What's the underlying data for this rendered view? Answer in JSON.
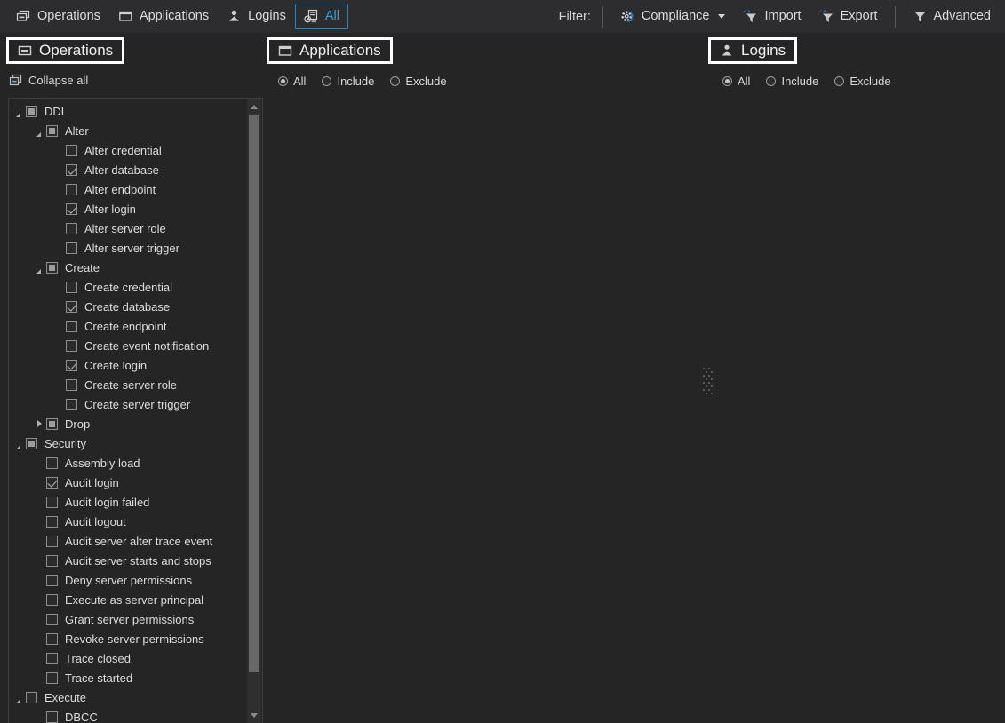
{
  "toolbar": {
    "left_buttons": [
      {
        "label": "Operations",
        "icon": "operations-icon",
        "active": false
      },
      {
        "label": "Applications",
        "icon": "applications-icon",
        "active": false
      },
      {
        "label": "Logins",
        "icon": "logins-icon",
        "active": false
      },
      {
        "label": "All",
        "icon": "all-icon",
        "active": true
      }
    ],
    "filter_label": "Filter:",
    "right_buttons": [
      {
        "label": "Compliance",
        "icon": "compliance-gear-icon",
        "has_caret": true
      },
      {
        "label": "Import",
        "icon": "import-funnel-icon",
        "has_caret": false
      },
      {
        "label": "Export",
        "icon": "export-funnel-icon",
        "has_caret": false
      },
      {
        "label": "Advanced",
        "icon": "funnel-icon",
        "has_caret": false
      }
    ],
    "accent_color": "#3a9bdc",
    "accent_border": "#1b8ad4"
  },
  "panels": {
    "operations": {
      "title": "Operations",
      "icon": "operations-icon",
      "collapse_all_label": "Collapse all",
      "collapse_all_icon": "collapse-all-icon"
    },
    "applications": {
      "title": "Applications",
      "icon": "applications-icon",
      "modes": [
        {
          "label": "All",
          "selected": true
        },
        {
          "label": "Include",
          "selected": false
        },
        {
          "label": "Exclude",
          "selected": false
        }
      ]
    },
    "logins": {
      "title": "Logins",
      "icon": "logins-icon",
      "modes": [
        {
          "label": "All",
          "selected": true
        },
        {
          "label": "Include",
          "selected": false
        },
        {
          "label": "Exclude",
          "selected": false
        }
      ]
    }
  },
  "tree": [
    {
      "label": "DDL",
      "level": 0,
      "expander": "open",
      "check": "indeterminate"
    },
    {
      "label": "Alter",
      "level": 1,
      "expander": "open",
      "check": "indeterminate"
    },
    {
      "label": "Alter credential",
      "level": 2,
      "expander": "none",
      "check": "unchecked"
    },
    {
      "label": "Alter database",
      "level": 2,
      "expander": "none",
      "check": "checked"
    },
    {
      "label": "Alter endpoint",
      "level": 2,
      "expander": "none",
      "check": "unchecked"
    },
    {
      "label": "Alter login",
      "level": 2,
      "expander": "none",
      "check": "checked"
    },
    {
      "label": "Alter server role",
      "level": 2,
      "expander": "none",
      "check": "unchecked"
    },
    {
      "label": "Alter server trigger",
      "level": 2,
      "expander": "none",
      "check": "unchecked"
    },
    {
      "label": "Create",
      "level": 1,
      "expander": "open",
      "check": "indeterminate"
    },
    {
      "label": "Create credential",
      "level": 2,
      "expander": "none",
      "check": "unchecked"
    },
    {
      "label": "Create database",
      "level": 2,
      "expander": "none",
      "check": "checked"
    },
    {
      "label": "Create endpoint",
      "level": 2,
      "expander": "none",
      "check": "unchecked"
    },
    {
      "label": "Create event notification",
      "level": 2,
      "expander": "none",
      "check": "unchecked"
    },
    {
      "label": "Create login",
      "level": 2,
      "expander": "none",
      "check": "checked"
    },
    {
      "label": "Create server role",
      "level": 2,
      "expander": "none",
      "check": "unchecked"
    },
    {
      "label": "Create server trigger",
      "level": 2,
      "expander": "none",
      "check": "unchecked"
    },
    {
      "label": "Drop",
      "level": 1,
      "expander": "closed",
      "check": "indeterminate"
    },
    {
      "label": "Security",
      "level": 0,
      "expander": "open",
      "check": "indeterminate"
    },
    {
      "label": "Assembly load",
      "level": 1,
      "expander": "none",
      "check": "unchecked"
    },
    {
      "label": "Audit login",
      "level": 1,
      "expander": "none",
      "check": "checked"
    },
    {
      "label": "Audit login failed",
      "level": 1,
      "expander": "none",
      "check": "unchecked"
    },
    {
      "label": "Audit logout",
      "level": 1,
      "expander": "none",
      "check": "unchecked"
    },
    {
      "label": "Audit server alter trace event",
      "level": 1,
      "expander": "none",
      "check": "unchecked"
    },
    {
      "label": "Audit server starts and stops",
      "level": 1,
      "expander": "none",
      "check": "unchecked"
    },
    {
      "label": "Deny server permissions",
      "level": 1,
      "expander": "none",
      "check": "unchecked"
    },
    {
      "label": "Execute as server principal",
      "level": 1,
      "expander": "none",
      "check": "unchecked"
    },
    {
      "label": "Grant server permissions",
      "level": 1,
      "expander": "none",
      "check": "unchecked"
    },
    {
      "label": "Revoke server permissions",
      "level": 1,
      "expander": "none",
      "check": "unchecked"
    },
    {
      "label": "Trace closed",
      "level": 1,
      "expander": "none",
      "check": "unchecked"
    },
    {
      "label": "Trace started",
      "level": 1,
      "expander": "none",
      "check": "unchecked"
    },
    {
      "label": "Execute",
      "level": 0,
      "expander": "open",
      "check": "unchecked"
    },
    {
      "label": "DBCC",
      "level": 1,
      "expander": "none",
      "check": "unchecked"
    }
  ],
  "scrollbar": {
    "up_arrow_icon": "scroll-up-arrow-icon",
    "down_arrow_icon": "scroll-down-arrow-icon"
  },
  "splitter": {
    "icon": "splitter-grip-icon"
  }
}
